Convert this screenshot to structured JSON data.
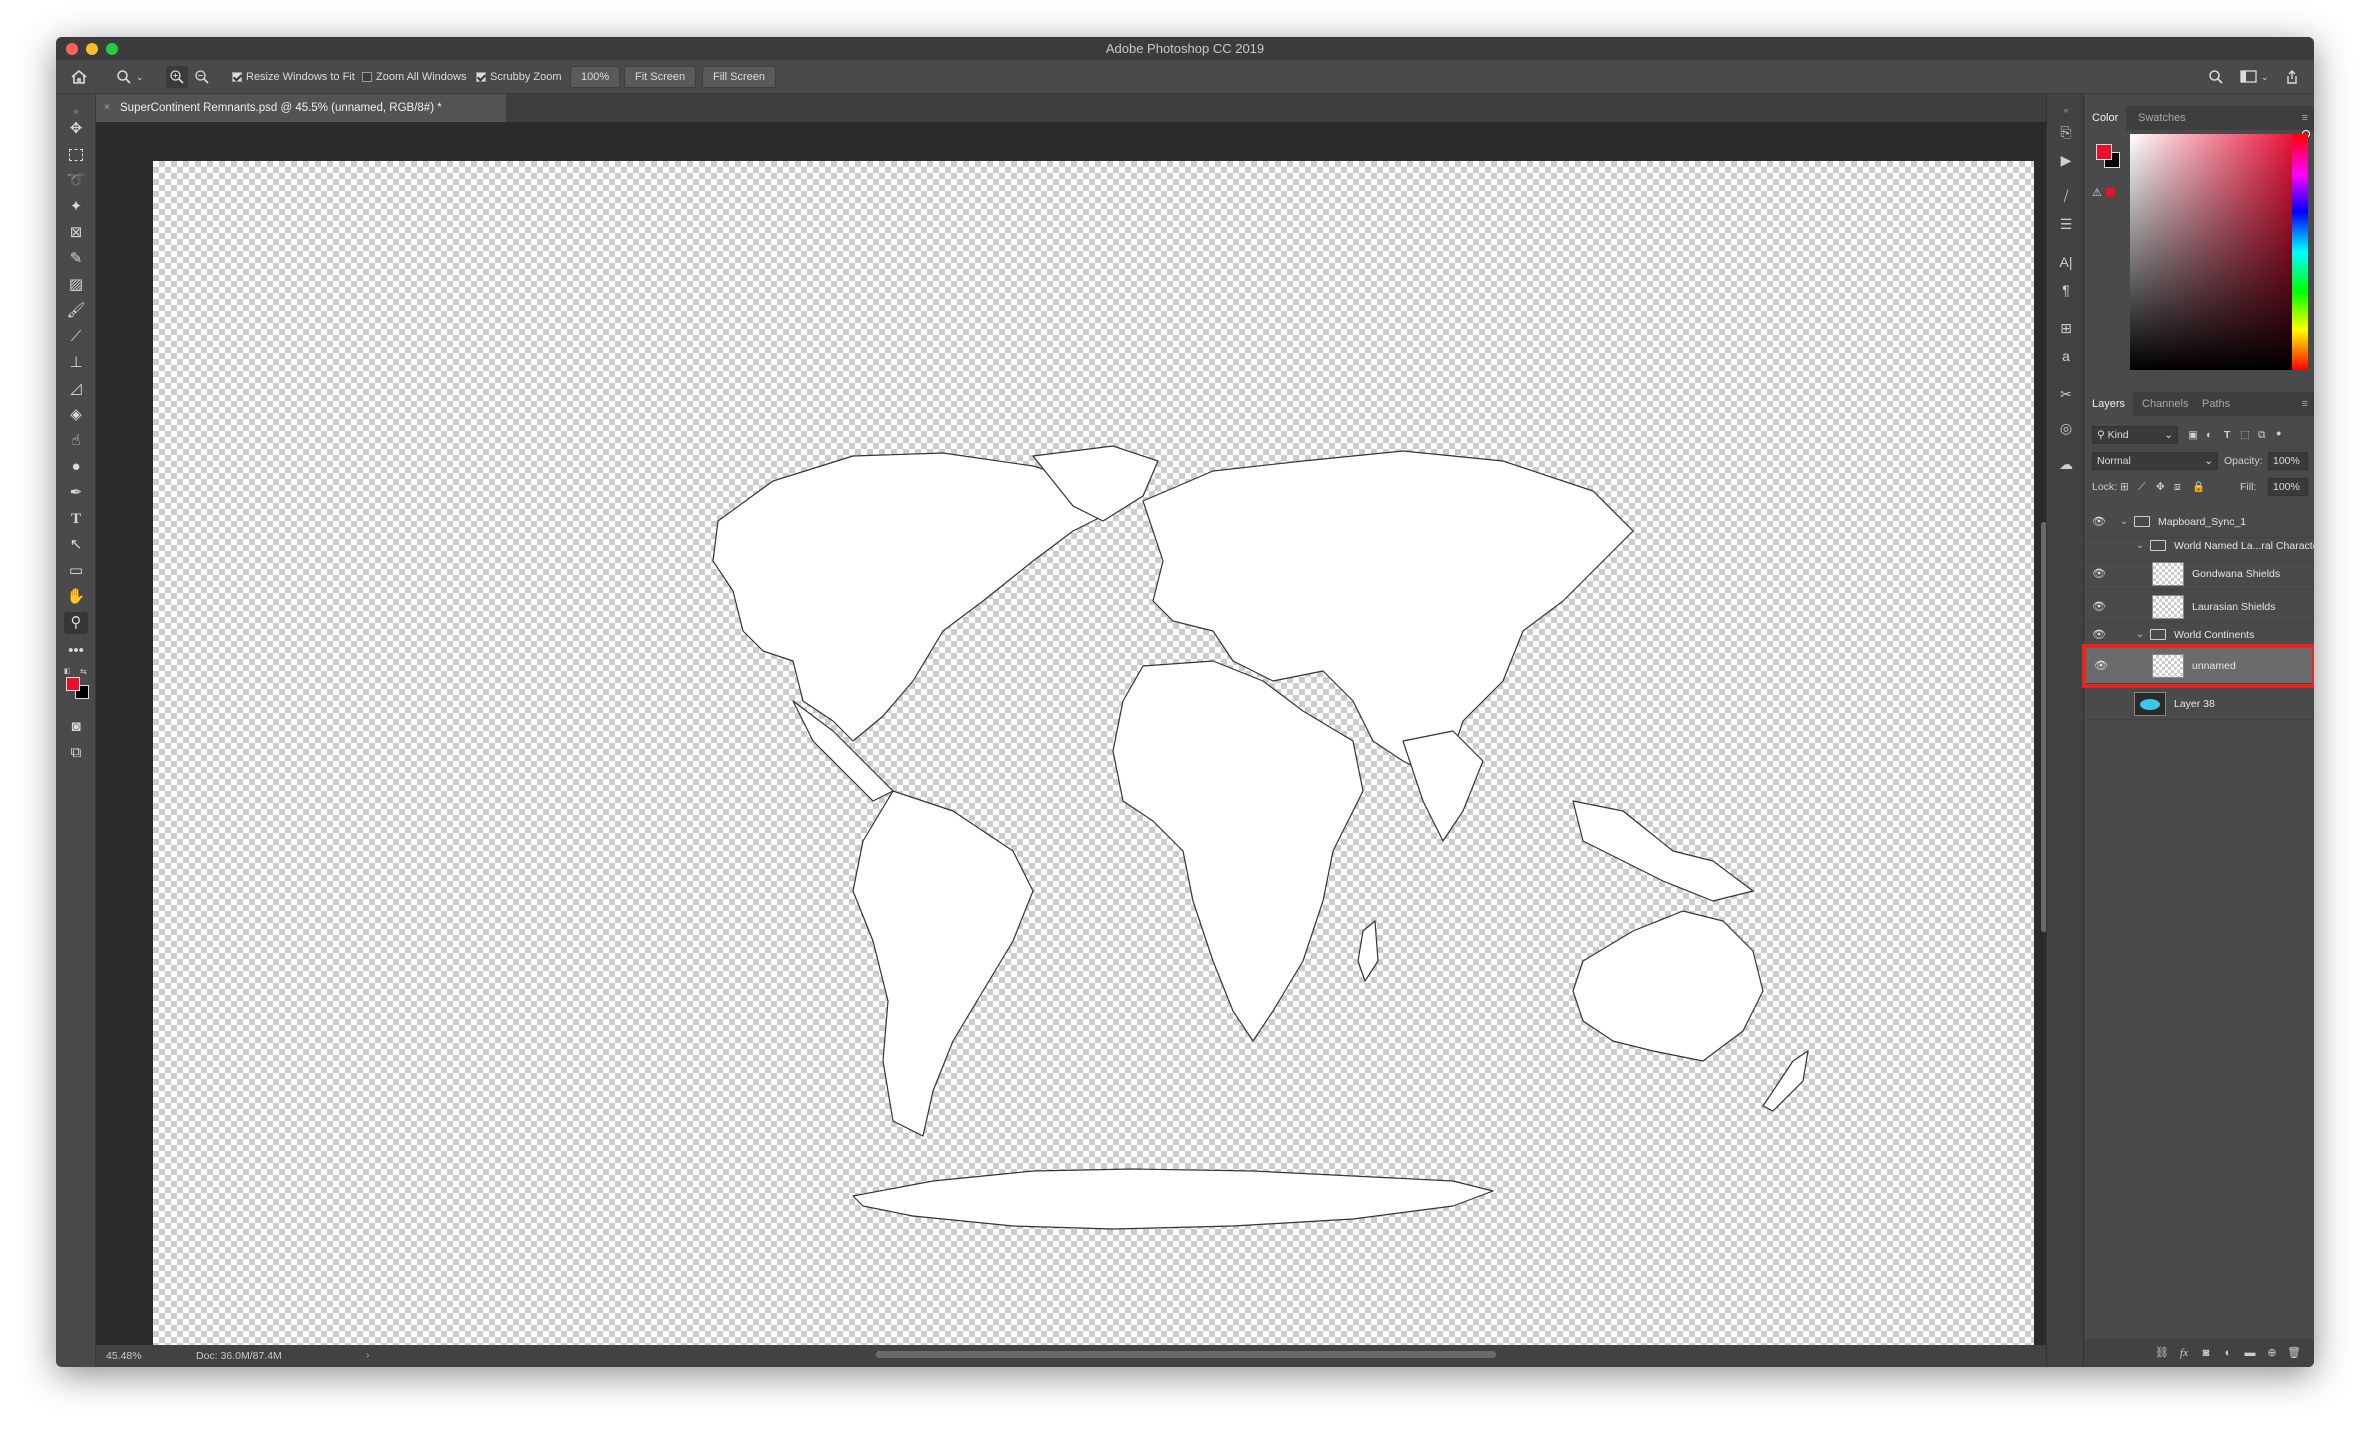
{
  "app": {
    "window_title": "Adobe Photoshop CC 2019"
  },
  "options_bar": {
    "resize_windows_label": "Resize Windows to Fit",
    "zoom_all_windows_label": "Zoom All Windows",
    "scrubby_zoom_label": "Scrubby Zoom",
    "zoom_value": "100%",
    "fit_screen_label": "Fit Screen",
    "fill_screen_label": "Fill Screen",
    "resize_windows_checked": true,
    "zoom_all_windows_checked": false,
    "scrubby_zoom_checked": true
  },
  "document": {
    "tab_title": "SuperContinent Remnants.psd @ 45.5% (unnamed, RGB/8#) *"
  },
  "status_bar": {
    "zoom": "45.48%",
    "doc_size": "Doc: 36.0M/87.4M"
  },
  "color_panel": {
    "tabs": [
      "Color",
      "Swatches"
    ],
    "foreground": "#e8102a",
    "background": "#000000"
  },
  "layers_panel": {
    "tabs": [
      "Layers",
      "Channels",
      "Paths"
    ],
    "filter_kind": "Kind",
    "blend_mode": "Normal",
    "opacity_label": "Opacity:",
    "opacity_value": "100%",
    "lock_label": "Lock:",
    "fill_label": "Fill:",
    "fill_value": "100%",
    "layers": [
      {
        "name": "Mapboard_Sync_1",
        "type": "group",
        "visible": true,
        "depth": 0
      },
      {
        "name": "World Named La...ral Character",
        "type": "group",
        "visible": false,
        "depth": 1
      },
      {
        "name": "Gondwana Shields",
        "type": "layer",
        "visible": true,
        "depth": 2
      },
      {
        "name": "Laurasian Shields",
        "type": "layer",
        "visible": true,
        "depth": 2
      },
      {
        "name": "World Continents",
        "type": "group",
        "visible": true,
        "depth": 1
      },
      {
        "name": "unnamed",
        "type": "layer",
        "visible": true,
        "depth": 2,
        "selected": true
      },
      {
        "name": "Layer 38",
        "type": "layer",
        "visible": false,
        "depth": 1
      }
    ],
    "highlight_color": "#e8251f"
  }
}
